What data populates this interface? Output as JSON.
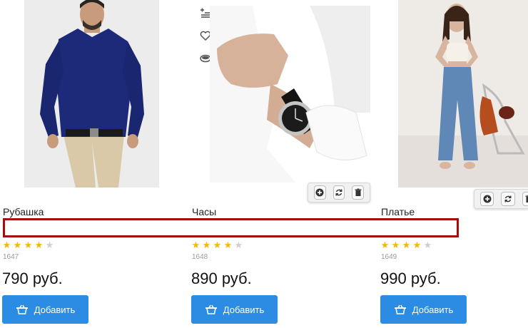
{
  "products": [
    {
      "title": "Рубашка",
      "rating": 4,
      "sku": "1647",
      "price": "790 руб.",
      "button_label": "Добавить"
    },
    {
      "title": "Часы",
      "rating": 4,
      "sku": "1648",
      "price": "890 руб.",
      "button_label": "Добавить"
    },
    {
      "title": "Платье",
      "rating": 4,
      "sku": "1649",
      "price": "990 руб.",
      "button_label": "Добавить"
    }
  ],
  "colors": {
    "accent": "#2c8ce4",
    "star": "#f6b800",
    "highlight": "#a50d0d"
  },
  "icons": {
    "side": [
      "compare-icon",
      "heart-icon",
      "eye-icon"
    ],
    "toolbar": [
      "add-circle-icon",
      "refresh-icon",
      "trash-icon"
    ],
    "button": "basket-icon"
  }
}
